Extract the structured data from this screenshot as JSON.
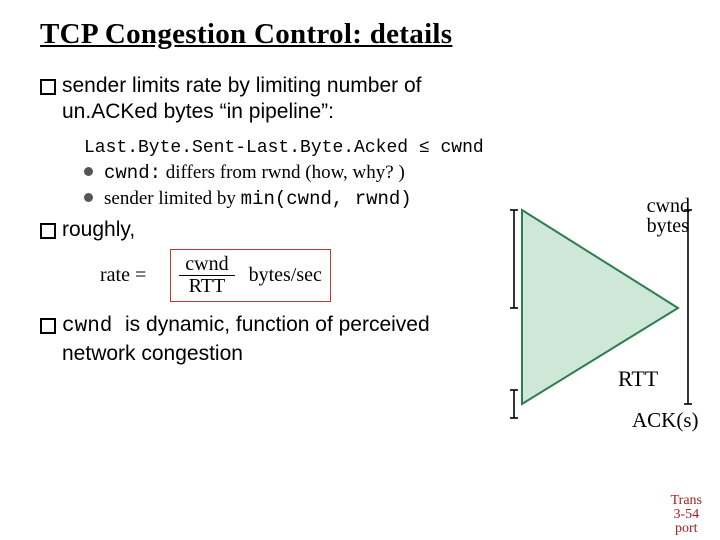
{
  "title": "TCP Congestion Control: details",
  "bullets": [
    {
      "text": "sender limits rate by limiting number of un.ACKed bytes “in pipeline”:"
    },
    {
      "text": "roughly,"
    },
    {
      "mono": "cwnd ",
      "text": " is dynamic, function of perceived network congestion"
    }
  ],
  "code": {
    "lhs": "Last.Byte.Sent-Last.Byte.Acked",
    "rhs": "cwnd"
  },
  "sub": [
    {
      "mono": "cwnd:",
      "rest": " differs from rwnd (how, why? )"
    },
    {
      "pre": "sender limited by ",
      "mono": "min(cwnd, rwnd)"
    }
  ],
  "rate": {
    "lhs": "rate =",
    "num": "cwnd",
    "den": "RTT",
    "units": "bytes/sec"
  },
  "diagram": {
    "cwnd1": "cwnd",
    "cwnd2": "bytes",
    "rtt": "RTT",
    "ack": "ACK(s)"
  },
  "footer": {
    "l1": "Trans",
    "l2": "3-54",
    "l3": "port"
  }
}
